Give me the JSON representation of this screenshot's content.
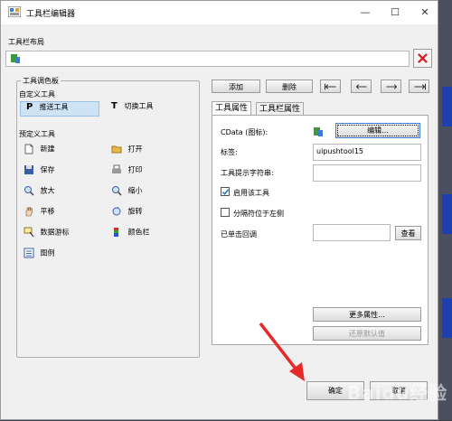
{
  "window": {
    "title": "工具栏编辑器"
  },
  "layout": {
    "label": "工具栏布局"
  },
  "palette": {
    "title": "工具调色板",
    "custom_title": "自定义工具",
    "custom_tools": [
      {
        "label": "推送工具",
        "icon": "p-push-icon"
      },
      {
        "label": "切换工具",
        "icon": "t-toggle-icon"
      }
    ],
    "predefined_title": "预定义工具",
    "predefined_tools": [
      {
        "label": "新建",
        "icon": "new-file-icon"
      },
      {
        "label": "打开",
        "icon": "folder-open-icon"
      },
      {
        "label": "保存",
        "icon": "save-disk-icon"
      },
      {
        "label": "打印",
        "icon": "printer-icon"
      },
      {
        "label": "放大",
        "icon": "zoom-in-icon"
      },
      {
        "label": "缩小",
        "icon": "zoom-out-icon"
      },
      {
        "label": "平移",
        "icon": "pan-hand-icon"
      },
      {
        "label": "旋转",
        "icon": "rotate-icon"
      },
      {
        "label": "数据游标",
        "icon": "data-cursor-icon"
      },
      {
        "label": "颜色栏",
        "icon": "colorbar-icon"
      },
      {
        "label": "图例",
        "icon": "legend-icon"
      }
    ]
  },
  "actions": {
    "add": "添加",
    "delete": "删除"
  },
  "tabs": [
    {
      "label": "工具属性"
    },
    {
      "label": "工具栏属性"
    }
  ],
  "props": {
    "cdata_label": "CData (图标):",
    "edit_button": "编辑...",
    "tag_label": "标签:",
    "tag_value": "uipushtool15",
    "tooltip_label": "工具提示字符串:",
    "tooltip_value": "",
    "enable_label": "启用该工具",
    "enable_checked": true,
    "separator_label": "分隔符位于左侧",
    "separator_checked": false,
    "callback_label": "已单击回调",
    "callback_value": "",
    "view_button": "查看",
    "more_button": "更多属性...",
    "restore_button": "还原默认值"
  },
  "footer": {
    "ok": "确定",
    "cancel": "取消"
  },
  "watermark": "Baidu经验"
}
